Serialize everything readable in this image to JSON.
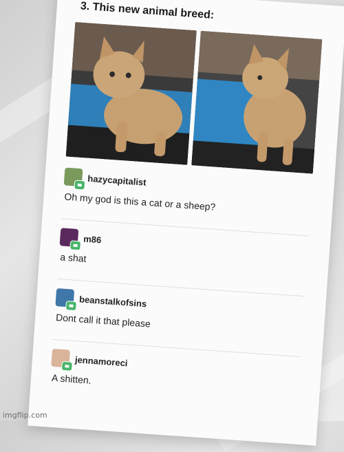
{
  "heading": "3. This new animal breed:",
  "posts": [
    {
      "username": "hazycapitalist",
      "text": "Oh my god is this a cat or a sheep?"
    },
    {
      "username": "m86",
      "text": "a shat"
    },
    {
      "username": "beanstalkofsins",
      "text": "Dont call it that please"
    },
    {
      "username": "jennamoreci",
      "text": "A shitten."
    }
  ],
  "watermark": "imgflip.com",
  "colors": {
    "paper": "#fbfbfb",
    "reblog_badge": "#49b56b",
    "cat_fur": "#c7a071"
  }
}
